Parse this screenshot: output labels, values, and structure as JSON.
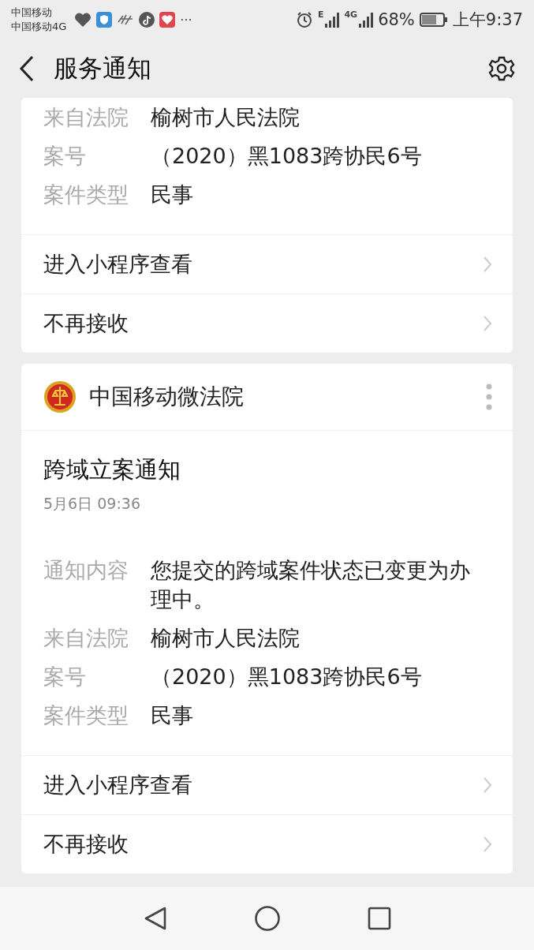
{
  "status_bar": {
    "carriers": [
      "中国移动",
      "中国移动4G"
    ],
    "more": "···",
    "network_1": "E",
    "network_2": "4G",
    "battery": "68%",
    "time": "上午9:37"
  },
  "header": {
    "title": "服务通知"
  },
  "cards": [
    {
      "fields": [
        {
          "label": "来自法院",
          "value": "榆树市人民法院"
        },
        {
          "label": "案号",
          "value": "（2020）黑1083跨协民6号"
        },
        {
          "label": "案件类型",
          "value": "民事"
        }
      ],
      "actions": [
        "进入小程序查看",
        "不再接收"
      ]
    },
    {
      "sender": "中国移动微法院",
      "title": "跨域立案通知",
      "time": "5月6日  09:36",
      "fields": [
        {
          "label": "通知内容",
          "value": "您提交的跨域案件状态已变更为办理中。"
        },
        {
          "label": "来自法院",
          "value": "榆树市人民法院"
        },
        {
          "label": "案号",
          "value": "（2020）黑1083跨协民6号"
        },
        {
          "label": "案件类型",
          "value": "民事"
        }
      ],
      "actions": [
        "进入小程序查看",
        "不再接收"
      ]
    }
  ]
}
